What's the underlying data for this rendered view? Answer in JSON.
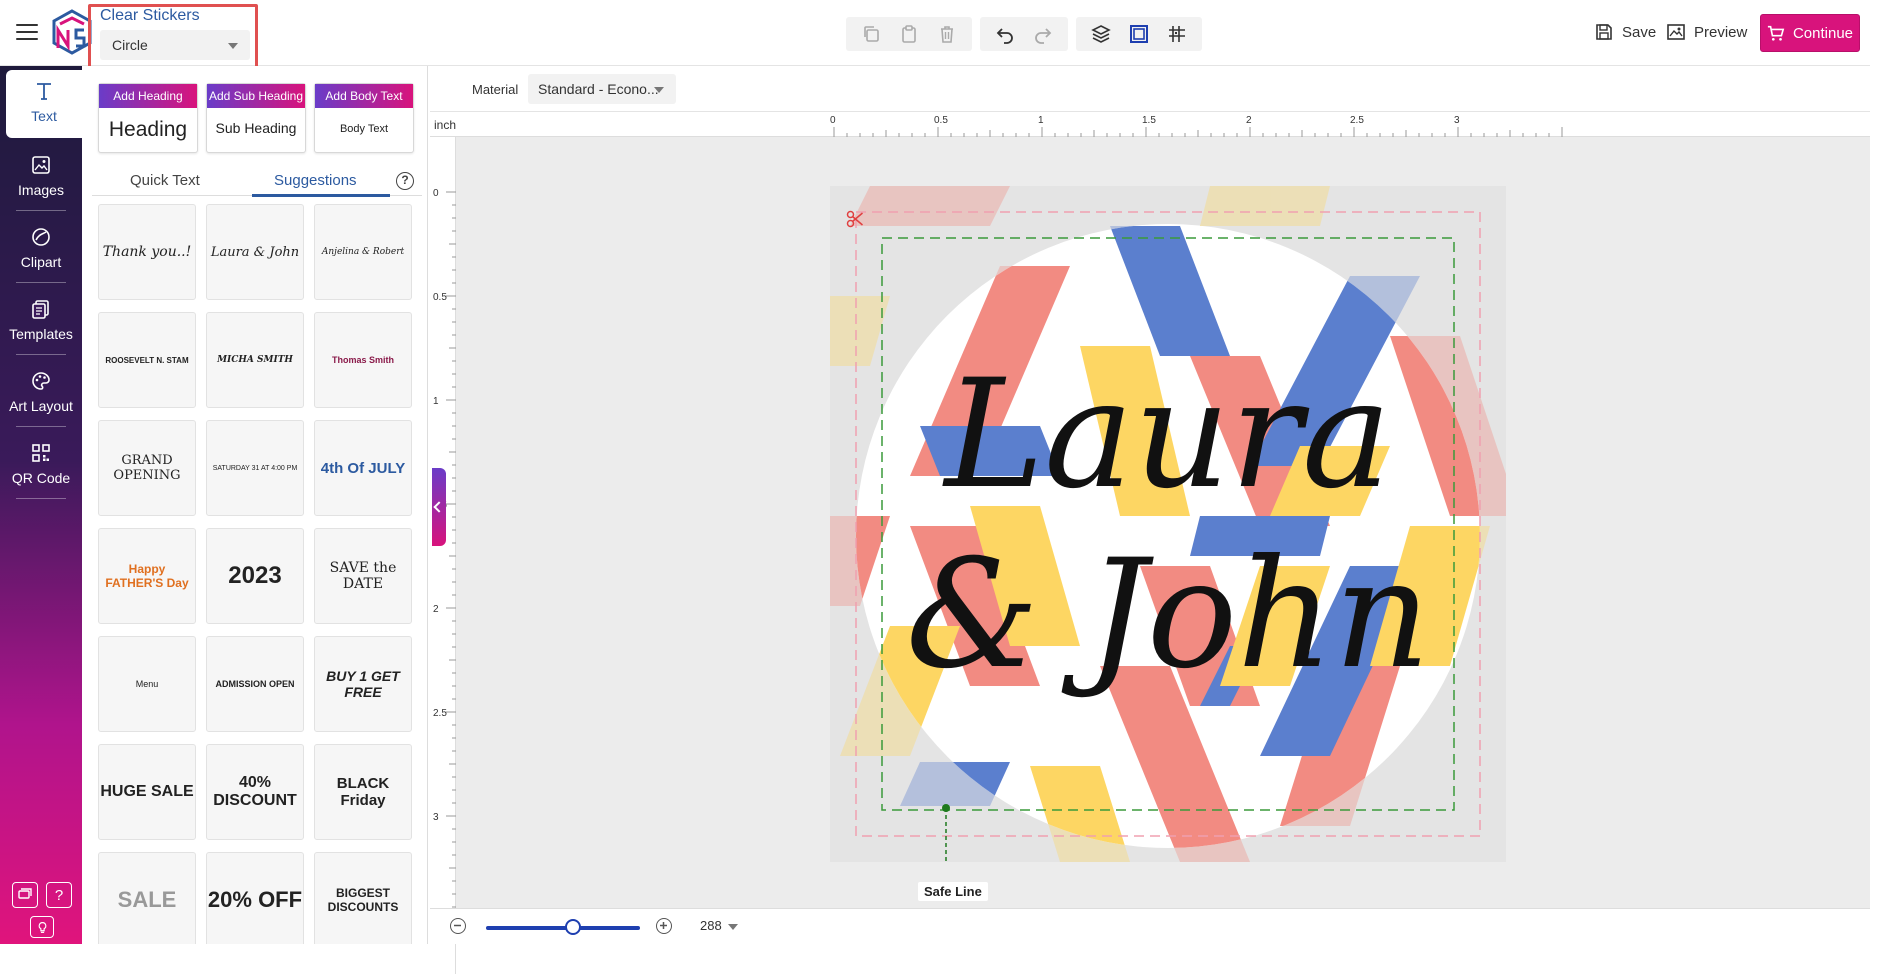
{
  "header": {
    "product_title": "Clear Stickers",
    "shape_value": "Circle",
    "save_label": "Save",
    "preview_label": "Preview",
    "continue_label": "Continue"
  },
  "sidebar": {
    "items": [
      {
        "label": "Text",
        "icon": "text-icon"
      },
      {
        "label": "Images",
        "icon": "image-icon"
      },
      {
        "label": "Clipart",
        "icon": "clipart-icon"
      },
      {
        "label": "Templates",
        "icon": "templates-icon"
      },
      {
        "label": "Art Layout",
        "icon": "palette-icon"
      },
      {
        "label": "QR Code",
        "icon": "qr-code-icon"
      }
    ],
    "help_label": "?"
  },
  "panel": {
    "add_heading_label": "Add Heading",
    "add_heading_sample": "Heading",
    "add_subheading_label": "Add Sub Heading",
    "add_subheading_sample": "Sub Heading",
    "add_body_label": "Add Body Text",
    "add_body_sample": "Body Text",
    "tab_quick": "Quick Text",
    "tab_suggestions": "Suggestions",
    "suggestions": [
      "Thank you..!",
      "Laura & John",
      "Anjelina & Robert",
      "ROOSEVELT N. STAM",
      "MICHA SMITH",
      "Thomas Smith",
      "GRAND OPENING",
      "SATURDAY 31 AT 4:00 PM",
      "4th Of JULY",
      "Happy FATHER'S Day",
      "2023",
      "SAVE the DATE",
      "Menu",
      "ADMISSION OPEN",
      "BUY 1 GET FREE",
      "HUGE SALE",
      "40% DISCOUNT",
      "BLACK Friday",
      "SALE",
      "20% OFF",
      "BIGGEST DISCOUNTS"
    ]
  },
  "canvas": {
    "material_label": "Material",
    "material_value": "Standard - Econo...",
    "unit_label": "inch",
    "ruler_top_labels": [
      "0",
      "0.5",
      "1",
      "1.5",
      "2",
      "2.5",
      "3"
    ],
    "ruler_left_labels": [
      "0",
      "0.5",
      "1",
      "1.5",
      "2",
      "2.5",
      "3"
    ],
    "sticker_text_line1": "Laura",
    "sticker_text_line2": "& John",
    "safe_line_label": "Safe Line",
    "zoom_value": "288"
  },
  "colors": {
    "accent": "#d8137c",
    "link": "#2c5aa0",
    "pattern_red": "#f28b82",
    "pattern_blue": "#5b7fce",
    "pattern_yellow": "#fdd663"
  }
}
